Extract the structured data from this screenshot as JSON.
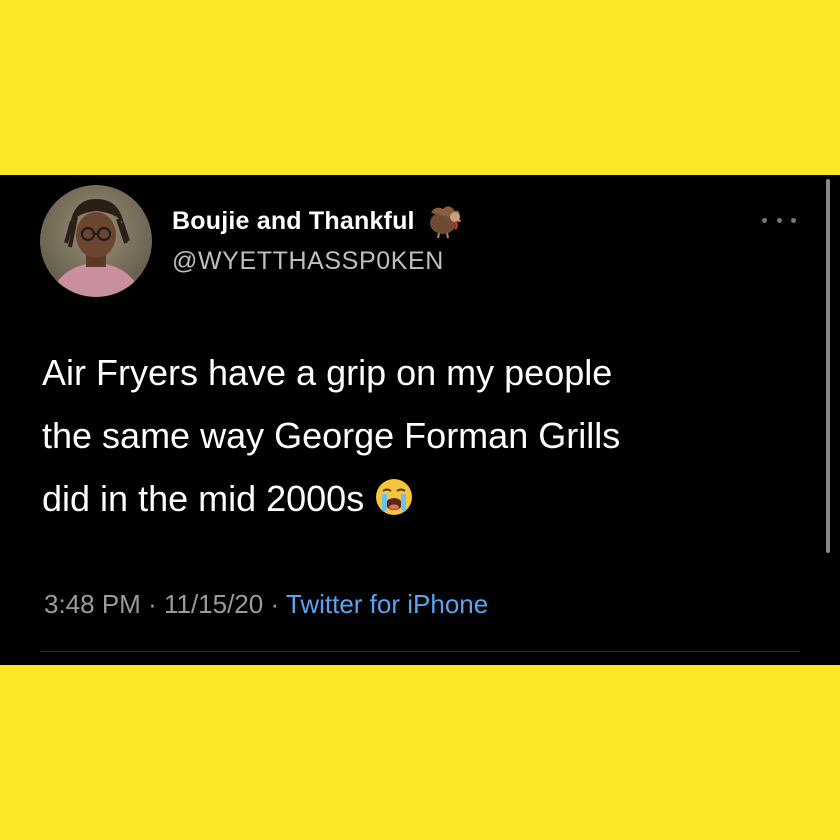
{
  "user": {
    "display_name": "Boujie and Thankful",
    "handle": "@WYETTHASSP0KEN",
    "name_emoji": "turkey-icon",
    "avatar": "avatar"
  },
  "tweet": {
    "lines": [
      "Air Fryers have a grip on my people",
      "the same way George Forman Grills",
      "did in the mid 2000s"
    ],
    "trailing_emoji": "loudly-crying-face-icon"
  },
  "meta": {
    "time": "3:48 PM",
    "date": "11/15/20",
    "separator": "·",
    "source": "Twitter for iPhone"
  },
  "colors": {
    "background": "#fce826",
    "card": "#000000",
    "link": "#5aa3f0",
    "muted": "#9a9a9a"
  }
}
